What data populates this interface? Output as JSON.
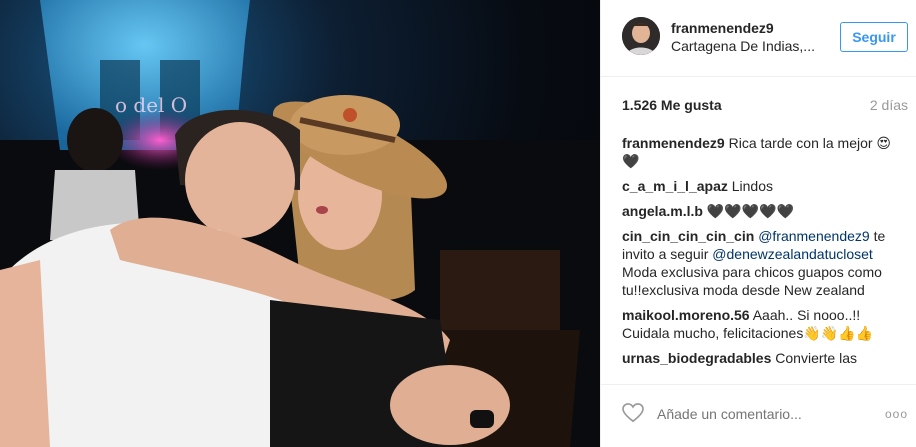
{
  "post": {
    "username": "franmenendez9",
    "location": "Cartagena De Indias,...",
    "follow_label": "Seguir",
    "likes": "1.526 Me gusta",
    "time": "2 días",
    "comments": [
      {
        "user": "franmenendez9",
        "text": "Rica tarde con la mejor 😍🖤"
      },
      {
        "user": "c_a_m_i_l_apaz",
        "text": "Lindos"
      },
      {
        "user": "angela.m.l.b",
        "text": "🖤🖤🖤🖤🖤"
      },
      {
        "user": "cin_cin_cin_cin_cin",
        "mention1": "@franmenendez9",
        "mid": " te invito a seguir ",
        "mention2": "@denewzealandatucloset",
        "rest": " Moda exclusiva para chicos guapos como tu!!exclusiva moda desde New zealand"
      },
      {
        "user": "maikool.moreno.56",
        "text": "Aaah.. Si nooo..!! Cuidala mucho, felicitaciones👋👋👍👍"
      },
      {
        "user": "urnas_biodegradables",
        "text": "Convierte las"
      }
    ],
    "add_comment_placeholder": "Añade un comentario...",
    "more_label": "ooo"
  }
}
